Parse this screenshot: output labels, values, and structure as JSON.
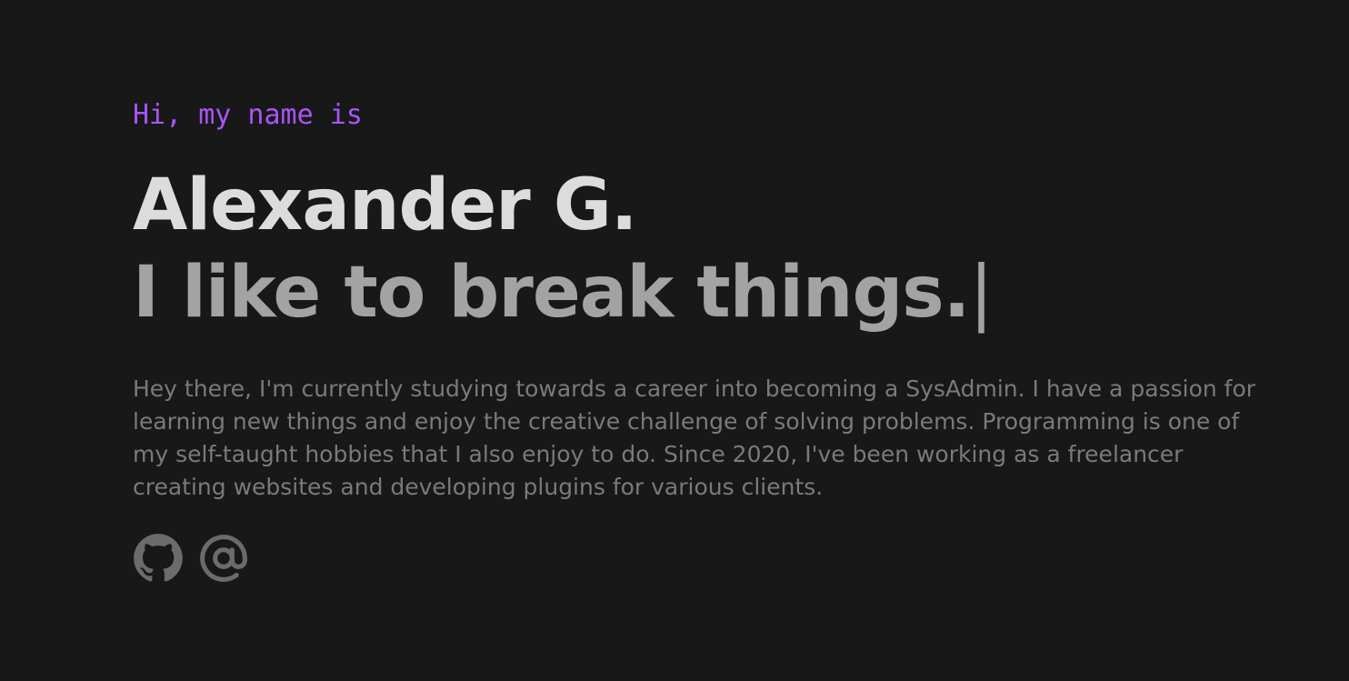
{
  "hero": {
    "greeting": "Hi, my name is",
    "name": "Alexander G.",
    "tagline": "I like to break things.",
    "cursor": "|",
    "bio": "Hey there, I'm currently studying towards a career into becoming a SysAdmin. I have a passion for learning new things and enjoy the creative challenge of solving problems. Programming is one of my self-taught hobbies that I also enjoy to do. Since 2020, I've been working as a freelancer creating websites and developing plugins for various clients."
  },
  "socials": [
    {
      "icon": "github-icon"
    },
    {
      "icon": "at-sign-icon"
    }
  ],
  "colors": {
    "background": "#181818",
    "accent": "#a855f7",
    "name": "#dcdcdc",
    "tagline": "#a3a3a3",
    "bio": "#7a7a7a",
    "icons": "#6b6b6b"
  }
}
